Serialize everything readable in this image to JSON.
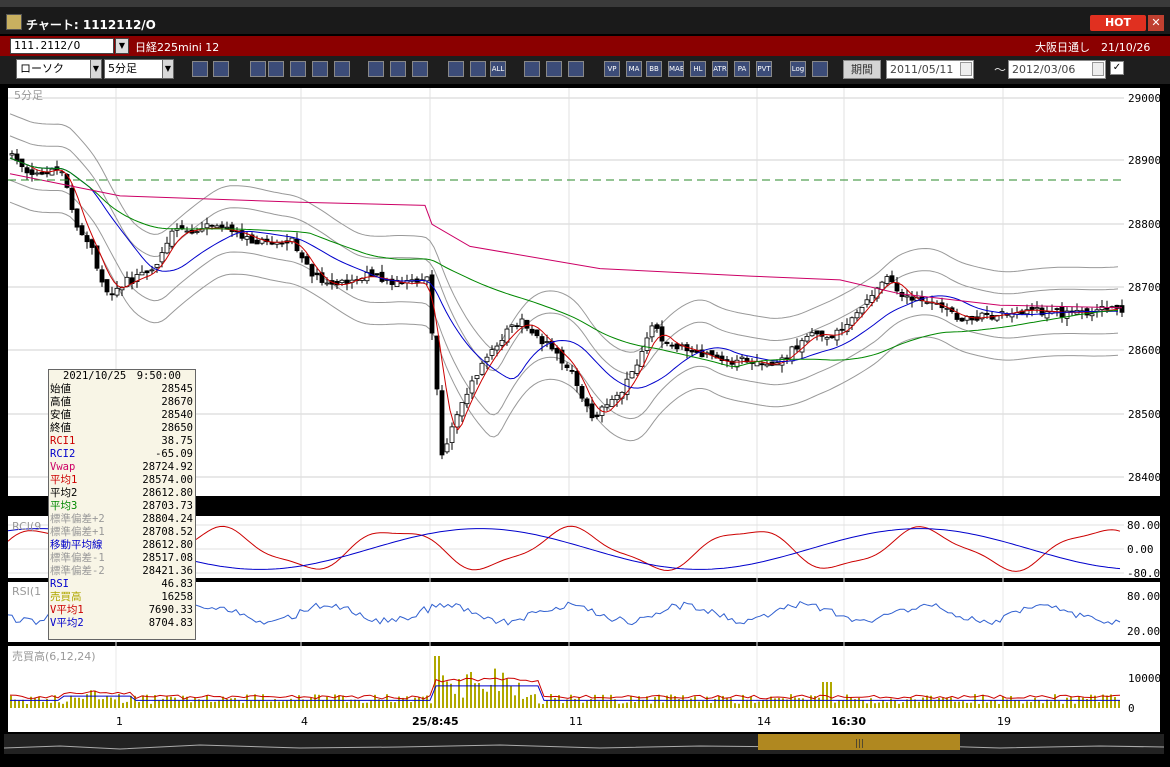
{
  "window": {
    "title": "チャート: 1112112/O",
    "hot_label": "HOT",
    "close_label": "✕"
  },
  "symbol": {
    "code": "111.2112/O",
    "name": "日経225mini 12",
    "market": "大阪日通し　21/10/26"
  },
  "toolbar": {
    "chart_type": "ローソク",
    "interval": "5分足",
    "buttons": [
      "zoom",
      "cursor",
      "ind1",
      "ind2",
      "ind3",
      "ind4",
      "ind5",
      "draw-line",
      "select",
      "redo",
      "bar1",
      "bar2",
      "ALL",
      "gear",
      "tool",
      "color",
      "VP",
      "MA",
      "BB",
      "MAE",
      "HL",
      "ATR",
      "PA",
      "PVT",
      "Log",
      "snap"
    ],
    "period_label": "期間",
    "date_from": "2011/05/11",
    "date_to": "2012/03/06",
    "tilde": "～"
  },
  "chart": {
    "main_label": "5分足",
    "price_ticks": [
      "29000",
      "28900",
      "28800",
      "28700",
      "28600",
      "28500",
      "28400"
    ],
    "rci_label": "RCI(9",
    "rci_ticks": [
      "80.00",
      "0.00",
      "-80.00"
    ],
    "rsi_label": "RSI(1",
    "rsi_ticks": [
      "80.00",
      "20.00"
    ],
    "vol_label": "売買高(6,12,24)",
    "vol_ticks": [
      "10000",
      "0"
    ],
    "x_labels": [
      "1",
      "4",
      "25/8:45",
      "11",
      "14",
      "16:30",
      "19"
    ],
    "colors": {
      "up": "#ffffff",
      "down": "#000000",
      "ma1": "#cc0000",
      "ma2": "#0000cc",
      "ma3": "#008800",
      "vwap": "#cc0066",
      "bb": "#999999",
      "rci1": "#cc0000",
      "rci2": "#0000cc",
      "rsi": "#3060d0",
      "volume": "#b0a800"
    }
  },
  "info": {
    "datetime": "2021/10/25　9:50:00",
    "rows": [
      {
        "label": "始値",
        "value": "28545",
        "color": "#000"
      },
      {
        "label": "高値",
        "value": "28670",
        "color": "#000"
      },
      {
        "label": "安値",
        "value": "28540",
        "color": "#000"
      },
      {
        "label": "終値",
        "value": "28650",
        "color": "#000"
      },
      {
        "label": "RCI1",
        "value": "38.75",
        "color": "#cc0000"
      },
      {
        "label": "RCI2",
        "value": "-65.09",
        "color": "#0000cc"
      },
      {
        "label": "Vwap",
        "value": "28724.92",
        "color": "#cc0066"
      },
      {
        "label": "平均1",
        "value": "28574.00",
        "color": "#cc0000"
      },
      {
        "label": "平均2",
        "value": "28612.80",
        "color": "#000000"
      },
      {
        "label": "平均3",
        "value": "28703.73",
        "color": "#008800"
      },
      {
        "label": "標準偏差+2",
        "value": "28804.24",
        "color": "#999999"
      },
      {
        "label": "標準偏差+1",
        "value": "28708.52",
        "color": "#999999"
      },
      {
        "label": "移動平均線",
        "value": "28612.80",
        "color": "#0000cc"
      },
      {
        "label": "標準偏差-1",
        "value": "28517.08",
        "color": "#999999"
      },
      {
        "label": "標準偏差-2",
        "value": "28421.36",
        "color": "#999999"
      },
      {
        "label": "RSI",
        "value": "46.83",
        "color": "#0000cc"
      },
      {
        "label": "売買高",
        "value": "16258",
        "color": "#b0a800"
      },
      {
        "label": "V平均1",
        "value": "7690.33",
        "color": "#cc0000"
      },
      {
        "label": "V平均2",
        "value": "8704.83",
        "color": "#0000cc"
      }
    ]
  }
}
